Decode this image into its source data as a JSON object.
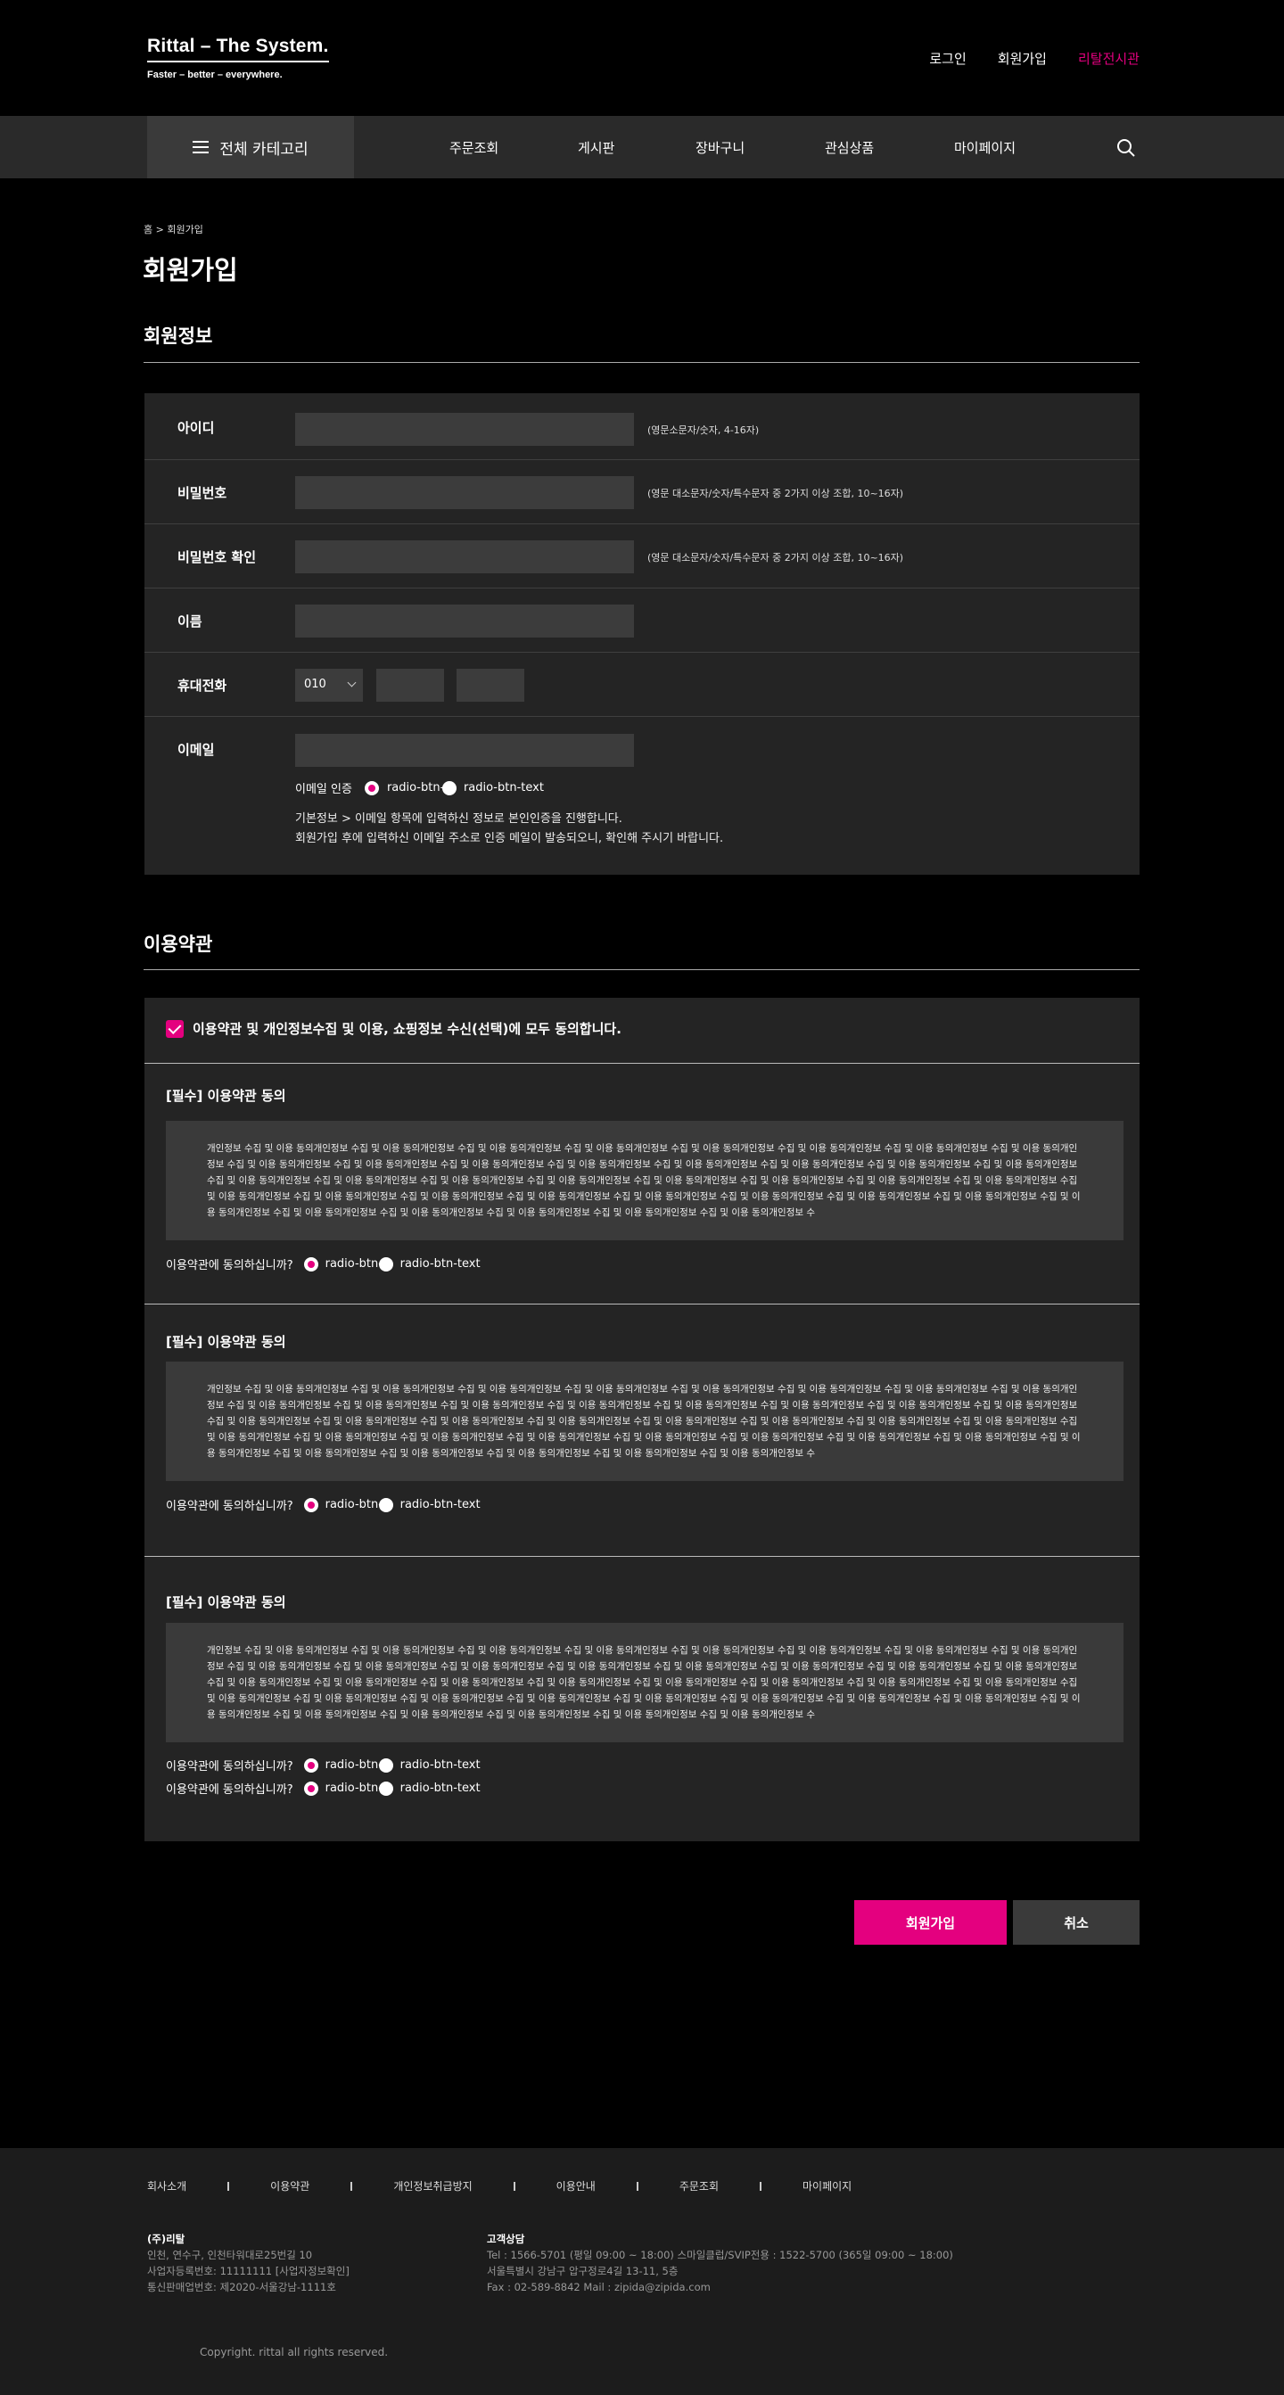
{
  "header": {
    "logo_brand": "Rittal – The System.",
    "logo_tagline": "Faster – better – everywhere.",
    "links": [
      "로그인",
      "회원가입",
      "리탈전시관"
    ]
  },
  "nav": {
    "all_category": "전체 카테고리",
    "items": [
      "주문조회",
      "게시판",
      "장바구니",
      "관심상품",
      "마이페이지"
    ]
  },
  "breadcrumb": "홈 > 회원가입",
  "page_title": "회원가입",
  "member_section": {
    "title": "회원정보",
    "fields": {
      "id": {
        "label": "아이디",
        "value": "",
        "hint": "(영문소문자/숫자, 4-16자)"
      },
      "password": {
        "label": "비밀번호",
        "value": "",
        "hint": "(영문 대소문자/숫자/특수문자 중 2가지 이상 조합, 10~16자)"
      },
      "password_confirm": {
        "label": "비밀번호 확인",
        "value": "",
        "hint": "(영문 대소문자/숫자/특수문자 중 2가지 이상 조합, 10~16자)"
      },
      "name": {
        "label": "이름",
        "value": ""
      },
      "phone": {
        "label": "휴대전화",
        "prefix": "010",
        "mid": "",
        "last": ""
      },
      "email": {
        "label": "이메일",
        "value": "",
        "verify_label": "이메일 인증",
        "radio_options": [
          "radio-btn-text",
          "radio-btn-text"
        ],
        "notes": [
          "기본정보 > 이메일 항목에 입력하신 정보로 본인인증을 진행합니다.",
          "회원가입 후에 입력하신 이메일 주소로 인증 메일이 발송되오니, 확인해 주시기 바랍니다."
        ]
      }
    }
  },
  "terms_section": {
    "title": "이용약관",
    "agree_all": "이용약관 및 개인정보수집 및 이용, 쇼핑정보 수신(선택)에 모두 동의합니다.",
    "terms": [
      {
        "title": "[필수] 이용약관 동의",
        "text": "개인정보 수집 및 이용 동의개인정보 수집 및 이용 동의개인정보 수집 및 이용 동의개인정보 수집 및 이용 동의개인정보 수집 및 이용 동의개인정보 수집 및 이용 동의개인정보 수집 및 이용 동의개인정보 수집 및 이용 동의개인정보 수집 및 이용 동의개인정보 수집 및 이용 동의개인정보 수집 및 이용 동의개인정보 수집 및 이용 동의개인정보 수집 및 이용 동의개인정보 수집 및 이용 동의개인정보 수집 및 이용 동의개인정보 수집 및 이용 동의개인정보 수집 및 이용 동의개인정보 수집 및 이용 동의개인정보 수집 및 이용 동의개인정보 수집 및 이용 동의개인정보 수집 및 이용 동의개인정보 수집 및 이용 동의개인정보 수집 및 이용 동의개인정보 수집 및 이용 동의개인정보 수집 및 이용 동의개인정보 수집 및 이용 동의개인정보 수집 및 이용 동의개인정보 수집 및 이용 동의개인정보 수집 및 이용 동의개인정보 수집 및 이용 동의개인정보 수집 및 이용 동의개인정보 수집 및 이용 동의개인정보 수집 및 이용 동의개인정보 수집 및 이용 동의개인정보 수집 및 이용 동의개인정보 수집 및 이용 동의개인정보 수집 및 이용 동의개인정보 수집 및 이용 동의개인정보 수",
        "questions": [
          {
            "label": "이용약관에 동의하십니까?",
            "options": [
              "radio-btn-text",
              "radio-btn-text"
            ]
          }
        ]
      },
      {
        "title": "[필수] 이용약관 동의",
        "text": "개인정보 수집 및 이용 동의개인정보 수집 및 이용 동의개인정보 수집 및 이용 동의개인정보 수집 및 이용 동의개인정보 수집 및 이용 동의개인정보 수집 및 이용 동의개인정보 수집 및 이용 동의개인정보 수집 및 이용 동의개인정보 수집 및 이용 동의개인정보 수집 및 이용 동의개인정보 수집 및 이용 동의개인정보 수집 및 이용 동의개인정보 수집 및 이용 동의개인정보 수집 및 이용 동의개인정보 수집 및 이용 동의개인정보 수집 및 이용 동의개인정보 수집 및 이용 동의개인정보 수집 및 이용 동의개인정보 수집 및 이용 동의개인정보 수집 및 이용 동의개인정보 수집 및 이용 동의개인정보 수집 및 이용 동의개인정보 수집 및 이용 동의개인정보 수집 및 이용 동의개인정보 수집 및 이용 동의개인정보 수집 및 이용 동의개인정보 수집 및 이용 동의개인정보 수집 및 이용 동의개인정보 수집 및 이용 동의개인정보 수집 및 이용 동의개인정보 수집 및 이용 동의개인정보 수집 및 이용 동의개인정보 수집 및 이용 동의개인정보 수집 및 이용 동의개인정보 수집 및 이용 동의개인정보 수집 및 이용 동의개인정보 수집 및 이용 동의개인정보 수집 및 이용 동의개인정보 수",
        "questions": [
          {
            "label": "이용약관에 동의하십니까?",
            "options": [
              "radio-btn-text",
              "radio-btn-text"
            ]
          }
        ]
      },
      {
        "title": "[필수] 이용약관 동의",
        "text": "개인정보 수집 및 이용 동의개인정보 수집 및 이용 동의개인정보 수집 및 이용 동의개인정보 수집 및 이용 동의개인정보 수집 및 이용 동의개인정보 수집 및 이용 동의개인정보 수집 및 이용 동의개인정보 수집 및 이용 동의개인정보 수집 및 이용 동의개인정보 수집 및 이용 동의개인정보 수집 및 이용 동의개인정보 수집 및 이용 동의개인정보 수집 및 이용 동의개인정보 수집 및 이용 동의개인정보 수집 및 이용 동의개인정보 수집 및 이용 동의개인정보 수집 및 이용 동의개인정보 수집 및 이용 동의개인정보 수집 및 이용 동의개인정보 수집 및 이용 동의개인정보 수집 및 이용 동의개인정보 수집 및 이용 동의개인정보 수집 및 이용 동의개인정보 수집 및 이용 동의개인정보 수집 및 이용 동의개인정보 수집 및 이용 동의개인정보 수집 및 이용 동의개인정보 수집 및 이용 동의개인정보 수집 및 이용 동의개인정보 수집 및 이용 동의개인정보 수집 및 이용 동의개인정보 수집 및 이용 동의개인정보 수집 및 이용 동의개인정보 수집 및 이용 동의개인정보 수집 및 이용 동의개인정보 수집 및 이용 동의개인정보 수집 및 이용 동의개인정보 수집 및 이용 동의개인정보 수",
        "questions": [
          {
            "label": "이용약관에 동의하십니까?",
            "options": [
              "radio-btn-text",
              "radio-btn-text"
            ]
          },
          {
            "label": "이용약관에 동의하십니까?",
            "options": [
              "radio-btn-text",
              "radio-btn-text"
            ]
          }
        ]
      }
    ]
  },
  "buttons": {
    "submit": "회원가입",
    "cancel": "취소"
  },
  "footer": {
    "links": [
      "회사소개",
      "이용약관",
      "개인정보취급방지",
      "이용안내",
      "주문조회",
      "마이페이지"
    ],
    "company": {
      "name": "(주)리탈",
      "lines": [
        "인천, 연수구, 인천타워대로25번길 10",
        "사업자등록번호: 11111111 [사업자정보확인]",
        "통신판매업번호: 제2020-서울강남-1111호"
      ]
    },
    "support": {
      "title": "고객상담",
      "lines": [
        "Tel : 1566-5701 (평일 09:00 ~ 18:00)   스마일클럽/SVIP전용 : 1522-5700 (365일 09:00 ~ 18:00)",
        "서울특별시 강남구 압구정로4길 13-11, 5층",
        "Fax : 02-589-8842   Mail : zipida@zipida.com"
      ]
    },
    "copyright": "Copyright. rittal all rights reserved."
  },
  "colors": {
    "accent": "#e4007f",
    "panel": "#242424",
    "nav": "#2a2a2a"
  }
}
